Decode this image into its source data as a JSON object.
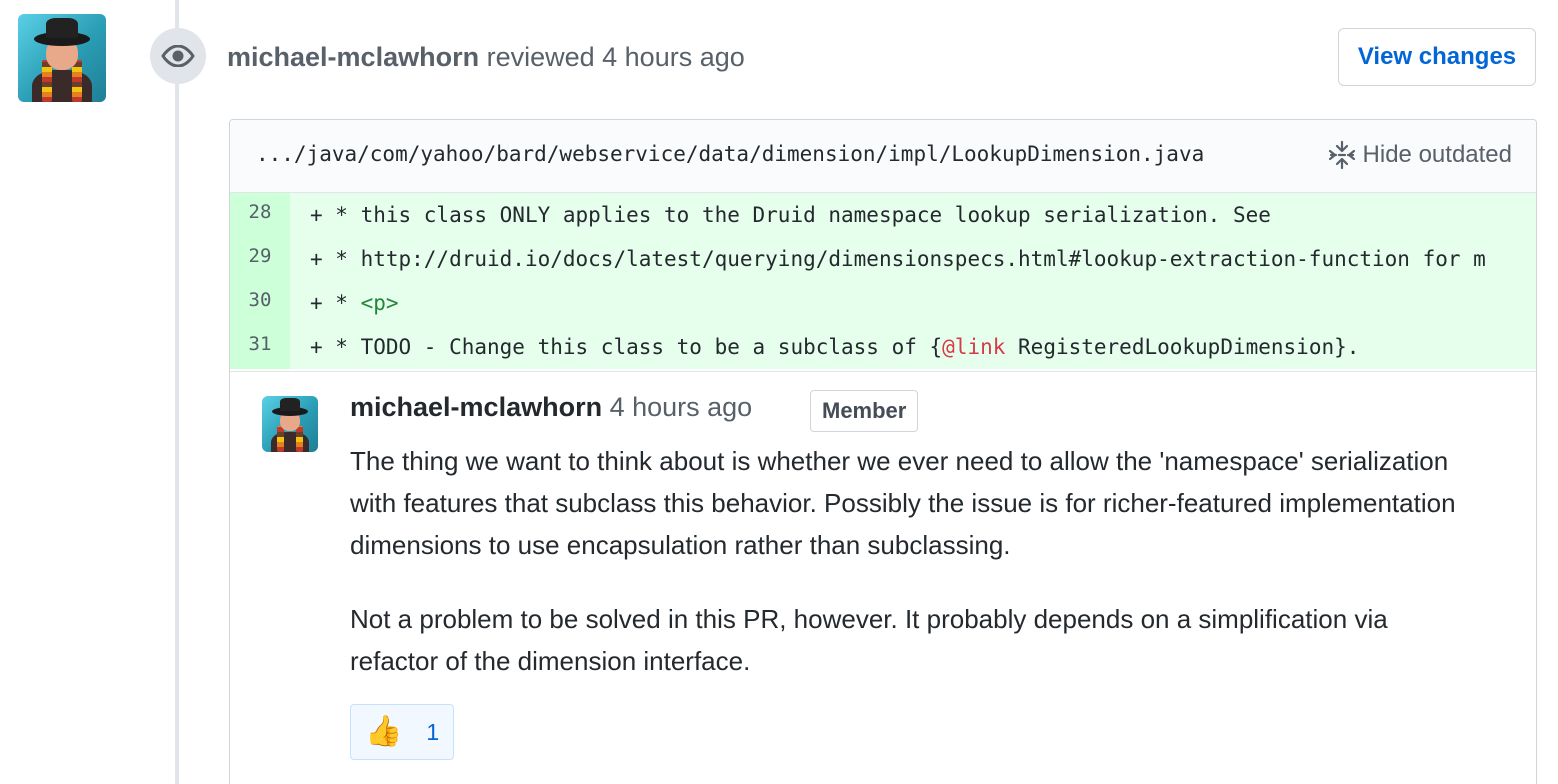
{
  "review": {
    "author": "michael-mclawhorn",
    "action": " reviewed ",
    "time": "4 hours ago",
    "view_changes_label": "View changes"
  },
  "file": {
    "path": ".../java/com/yahoo/bard/webservice/data/dimension/impl/LookupDimension.java",
    "hide_outdated_label": "Hide outdated"
  },
  "diff": {
    "lines": [
      {
        "num": "28",
        "prefix": "+ * ",
        "text": "this class ONLY applies to the Druid namespace lookup serialization. See"
      },
      {
        "num": "29",
        "prefix": "+ * ",
        "text": "http://druid.io/docs/latest/querying/dimensionspecs.html#lookup-extraction-function for m"
      },
      {
        "num": "30",
        "prefix": "+ * ",
        "text": "<p>"
      },
      {
        "num": "31",
        "prefix": "+ * ",
        "text_before": "TODO - Change this class to be a subclass of {",
        "keyword": "@link",
        "text_after": " RegisteredLookupDimension}."
      }
    ]
  },
  "comment": {
    "author": "michael-mclawhorn",
    "time": " 4 hours ago",
    "badge": "Member",
    "paragraphs": [
      "The thing we want to think about is whether we ever need to allow the 'namespace' serialization with features that subclass this behavior. Possibly the issue is for richer-featured implementation dimensions to use encapsulation rather than subclassing.",
      "Not a problem to be solved in this PR, however. It probably depends on a simplification via refactor of the dimension interface."
    ],
    "reaction": {
      "emoji": "👍",
      "count": "1"
    }
  },
  "icons": {
    "eye": "eye-icon",
    "unfold": "unfold-icon"
  },
  "colors": {
    "link": "#0366d6",
    "diff_add_bg": "#e6ffed",
    "diff_add_num_bg": "#cdffd8",
    "timeline": "#e1e4e8"
  }
}
